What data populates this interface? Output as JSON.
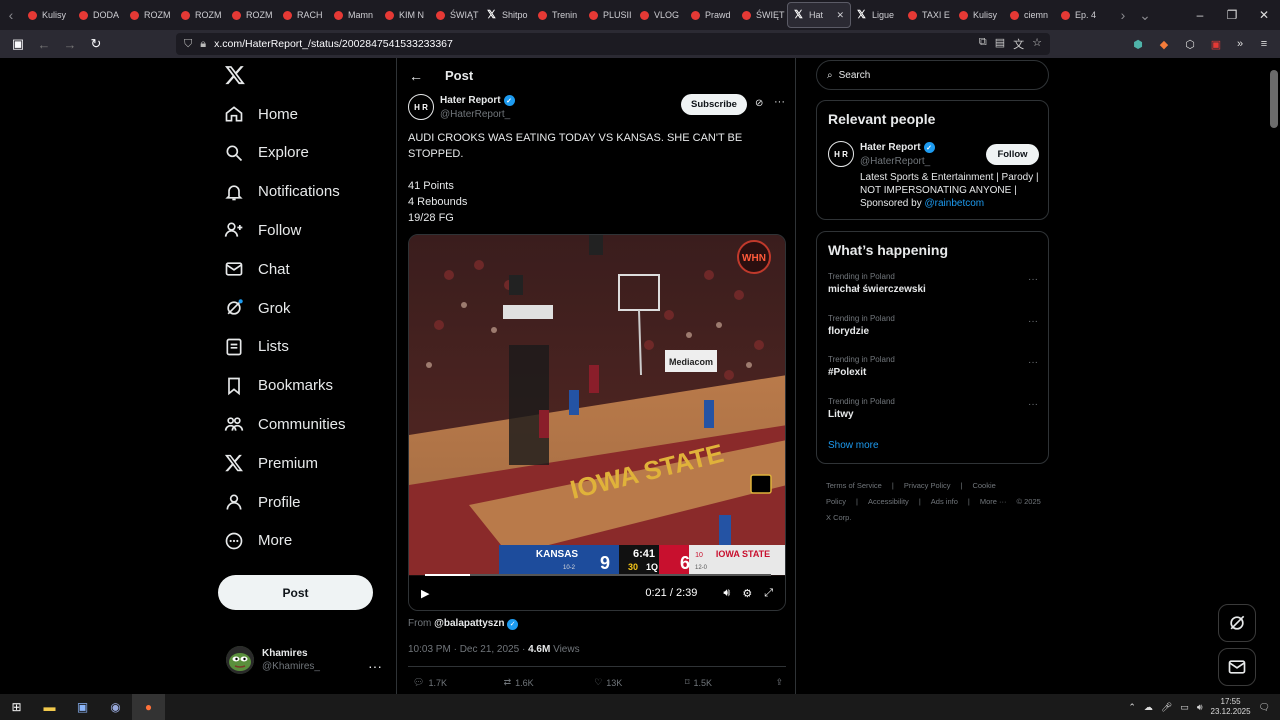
{
  "browser": {
    "tabs": [
      {
        "label": "Kulisy",
        "icon": "youtube-icon"
      },
      {
        "label": "DODA",
        "icon": "youtube-icon"
      },
      {
        "label": "ROZM",
        "icon": "youtube-icon"
      },
      {
        "label": "ROZM",
        "icon": "youtube-icon"
      },
      {
        "label": "ROZM",
        "icon": "youtube-icon"
      },
      {
        "label": "RACH",
        "icon": "youtube-icon"
      },
      {
        "label": "Mamn",
        "icon": "youtube-icon"
      },
      {
        "label": "KIM N",
        "icon": "youtube-icon"
      },
      {
        "label": "ŚWIĄT",
        "icon": "youtube-icon"
      },
      {
        "label": "Shitpo",
        "icon": "x-icon"
      },
      {
        "label": "Trenin",
        "icon": "youtube-icon"
      },
      {
        "label": "PLUSII",
        "icon": "youtube-icon"
      },
      {
        "label": "VLOG",
        "icon": "youtube-icon"
      },
      {
        "label": "Prawd",
        "icon": "youtube-icon"
      },
      {
        "label": "ŚWIĘT",
        "icon": "youtube-icon"
      },
      {
        "label": "Hat",
        "icon": "x-icon",
        "active": true
      },
      {
        "label": "Ligue",
        "icon": "x-icon"
      },
      {
        "label": "TAXI E",
        "icon": "youtube-icon"
      },
      {
        "label": "Kulisy",
        "icon": "youtube-icon"
      },
      {
        "label": "ciemn",
        "icon": "youtube-icon"
      },
      {
        "label": "Ep. 4",
        "icon": "youtube-icon"
      }
    ],
    "url": "x.com/HaterReport_/status/2002847541533233367"
  },
  "nav": {
    "items": [
      {
        "label": "Home",
        "icon": "home-icon"
      },
      {
        "label": "Explore",
        "icon": "search-icon"
      },
      {
        "label": "Notifications",
        "icon": "bell-icon"
      },
      {
        "label": "Follow",
        "icon": "follow-icon"
      },
      {
        "label": "Chat",
        "icon": "mail-icon"
      },
      {
        "label": "Grok",
        "icon": "grok-icon"
      },
      {
        "label": "Lists",
        "icon": "list-icon"
      },
      {
        "label": "Bookmarks",
        "icon": "bookmark-icon"
      },
      {
        "label": "Communities",
        "icon": "communities-icon"
      },
      {
        "label": "Premium",
        "icon": "x-icon"
      },
      {
        "label": "Profile",
        "icon": "profile-icon"
      },
      {
        "label": "More",
        "icon": "more-icon"
      }
    ],
    "post_label": "Post",
    "user": {
      "name": "Khamires",
      "handle": "@Khamires_"
    }
  },
  "post": {
    "header": "Post",
    "author": {
      "name": "Hater Report",
      "handle": "@HaterReport_",
      "avatar_text": "H R"
    },
    "subscribe_label": "Subscribe",
    "text": "AUDI CROOKS WAS EATING TODAY VS KANSAS. SHE CAN'T BE STOPPED.",
    "stats": [
      "41 Points",
      "4 Rebounds",
      "19/28 FG"
    ],
    "video": {
      "time": "0:21 / 2:39",
      "progress": 0.13,
      "scoreboard": {
        "team1": "KANSAS",
        "record1": "10-2",
        "score1": "9",
        "clock": "6:41",
        "shot_clock": "30",
        "period": "1Q",
        "team2": "IOWA STATE",
        "rank2": "10",
        "record2": "12-0",
        "score2": "6"
      },
      "watermark": "WHN",
      "ad_sign": "Mediacom",
      "court_text": "IOWA STATE"
    },
    "from_label": "From",
    "from_handle": "@balapattyszn",
    "time": "10:03 PM · Dec 21, 2025",
    "views_count": "4.6M",
    "views_label": "Views",
    "actions": {
      "replies": "1.7K",
      "reposts": "1.6K",
      "likes": "13K",
      "bookmarks": "1.5K"
    }
  },
  "sidebar": {
    "search_placeholder": "Search",
    "relevant_title": "Relevant people",
    "relevant_person": {
      "name": "Hater Report",
      "handle": "@HaterReport_",
      "follow_label": "Follow",
      "bio": "Latest Sports & Entertainment | Parody | NOT IMPERSONATING ANYONE | Sponsored by",
      "bio_link": "@rainbetcom"
    },
    "happening_title": "What’s happening",
    "trends": [
      {
        "context": "Trending in Poland",
        "name": "michał świerczewski"
      },
      {
        "context": "Trending in Poland",
        "name": "florydzie"
      },
      {
        "context": "Trending in Poland",
        "name": "#Polexit"
      },
      {
        "context": "Trending in Poland",
        "name": "Litwy"
      }
    ],
    "show_more": "Show more",
    "footer": [
      "Terms of Service",
      "|",
      "Privacy Policy",
      "|",
      "Cookie Policy",
      "|",
      "Accessibility",
      "|",
      "Ads info",
      "|",
      "More ···",
      "© 2025 X Corp."
    ]
  },
  "taskbar": {
    "time": "17:55",
    "date": "23.12.2025"
  }
}
